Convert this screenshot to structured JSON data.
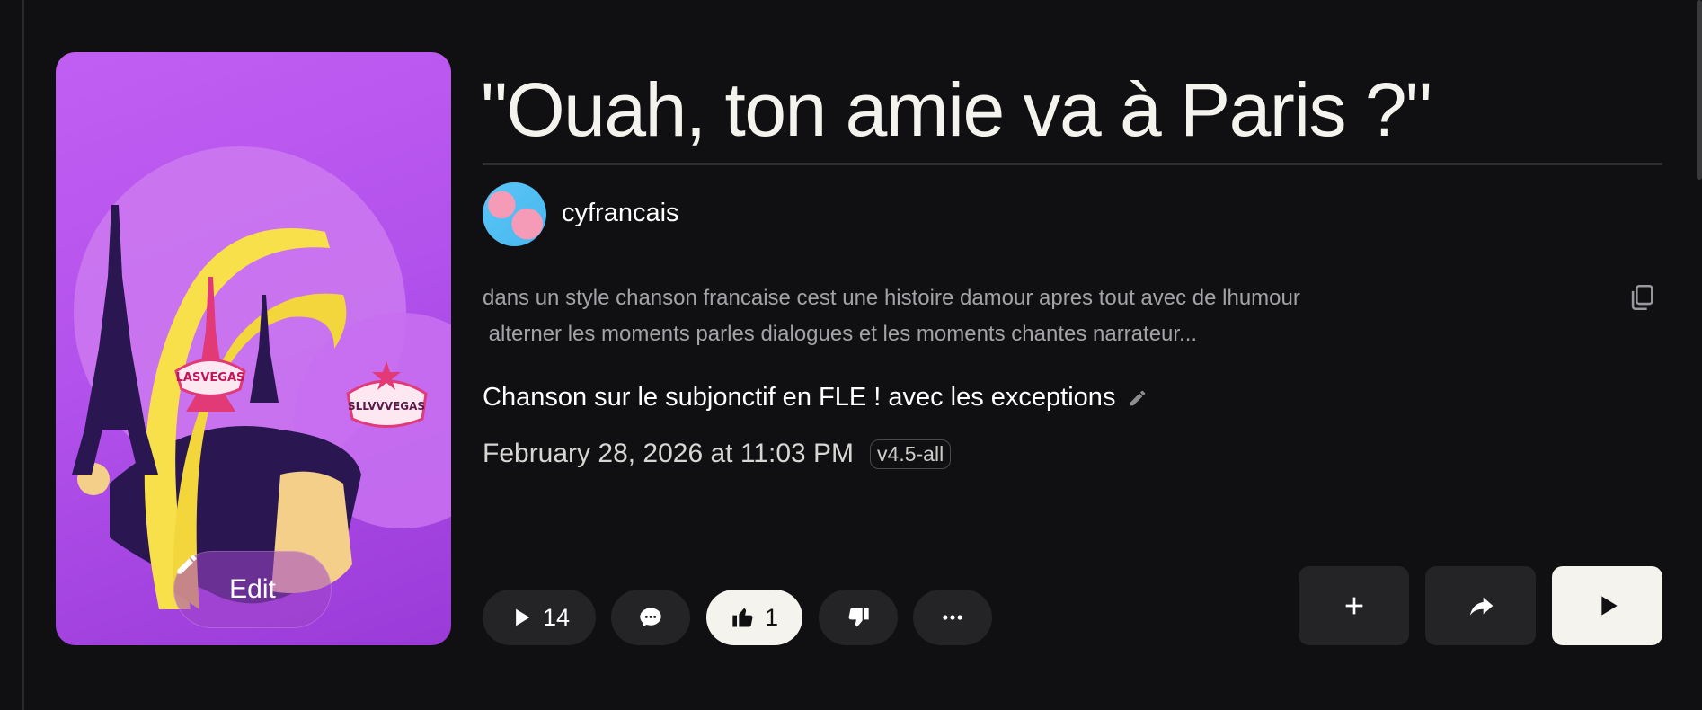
{
  "song": {
    "title": "\"Ouah, ton amie va à Paris ?\"",
    "author": "cyfrancais",
    "prompt_line1": "dans un style chanson francaise cest une histoire damour apres tout avec de lhumour",
    "prompt_line2": " alterner les moments parles dialogues et les moments chantes narrateur...",
    "subtitle": "Chanson sur le subjonctif en FLE ! avec les exceptions",
    "date": "February 28, 2026 at 11:03 PM",
    "version": "v4.5-all"
  },
  "cover": {
    "edit_label": "Edit",
    "sign_left": "LASVEGAS",
    "sign_right": "SLLVVVEGAS"
  },
  "actions": {
    "plays": "14",
    "likes": "1"
  },
  "icons": {
    "copy": "copy-icon",
    "edit": "pencil-icon",
    "play": "play-icon",
    "comment": "comment-icon",
    "like": "thumbs-up-icon",
    "dislike": "thumbs-down-icon",
    "more": "more-icon",
    "add": "plus-icon",
    "share": "share-icon"
  },
  "colors": {
    "background": "#101012",
    "pill": "#242427",
    "active": "#f5f3ee",
    "cover_purple": "#b352ec"
  }
}
